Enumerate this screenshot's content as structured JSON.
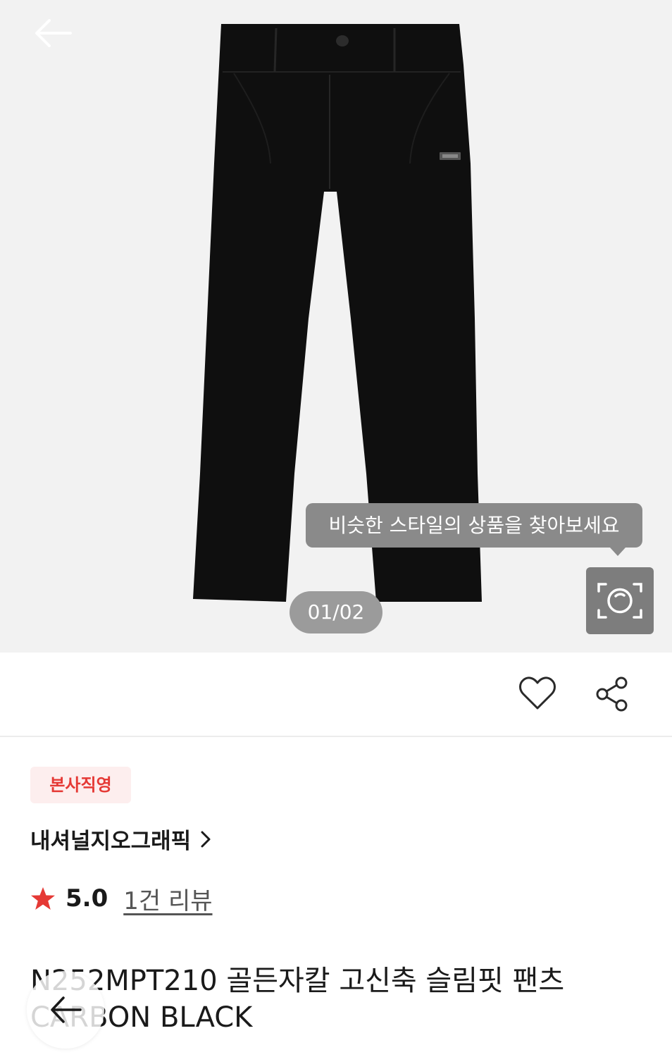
{
  "hero": {
    "tooltip": "비슷한 스타일의 상품을 찾아보세요",
    "counter": "01/02"
  },
  "product": {
    "badge": "본사직영",
    "brand": "내셔널지오그래픽",
    "rating": "5.0",
    "reviews": "1건 리뷰",
    "title": "N252MPT210 골든자칼 고신축 슬림핏 팬츠 CARBON BLACK"
  },
  "colors": {
    "accent": "#e53935",
    "hero_bg": "#f2f2f2",
    "badge_bg": "#fdeeee"
  },
  "icons": [
    "back-arrow-icon",
    "lens-search-icon",
    "heart-icon",
    "share-icon",
    "star-icon",
    "chevron-right-icon"
  ]
}
